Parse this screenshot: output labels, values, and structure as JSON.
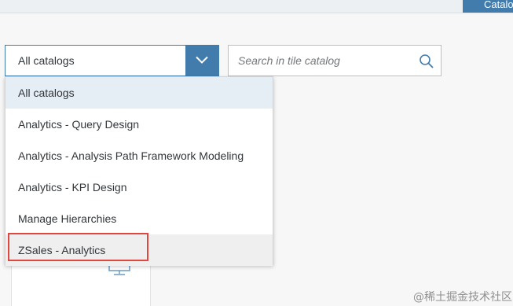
{
  "header": {
    "button_label": "Catalog"
  },
  "catalog_select": {
    "value": "All catalogs",
    "arrow_icon": "chevron-down-icon",
    "accent_color": "#427cac"
  },
  "search": {
    "placeholder": "Search in tile catalog",
    "value": "",
    "icon": "search-icon"
  },
  "dropdown": {
    "selected_index": 0,
    "hovered_index": 5,
    "items": [
      {
        "label": "All catalogs"
      },
      {
        "label": "Analytics - Query Design"
      },
      {
        "label": "Analytics - Analysis Path Framework Modeling"
      },
      {
        "label": "Analytics - KPI Design"
      },
      {
        "label": "Manage Hierarchies"
      },
      {
        "label": "ZSales - Analytics"
      }
    ]
  },
  "annotation": {
    "highlight_color": "#e0473e"
  },
  "watermark": "@稀土掘金技术社区"
}
